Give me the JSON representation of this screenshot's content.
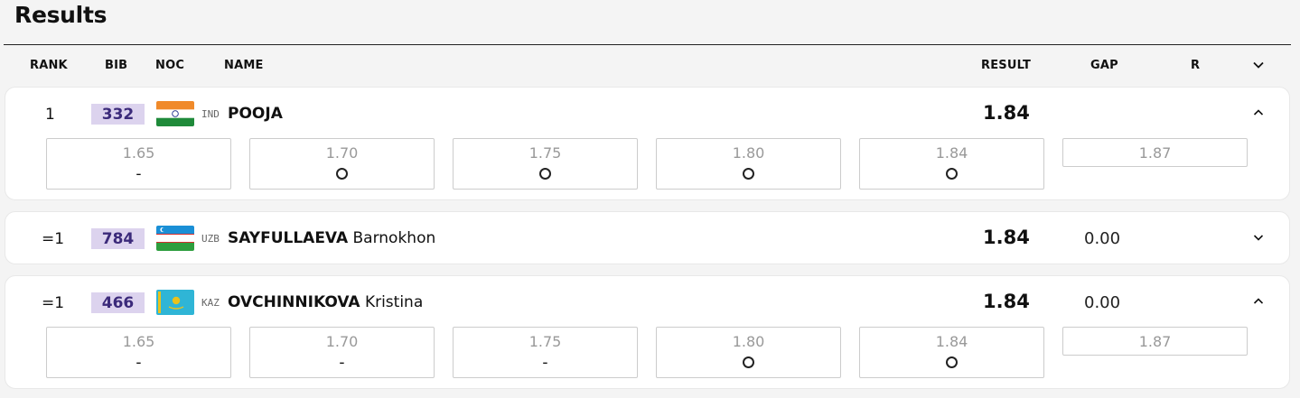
{
  "title": "Results",
  "headers": {
    "rank": "RANK",
    "bib": "BIB",
    "noc": "NOC",
    "name": "NAME",
    "result": "RESULT",
    "gap": "GAP",
    "r": "R"
  },
  "rows": [
    {
      "rank": "1",
      "bib": "332",
      "noc": "IND",
      "last": "POOJA",
      "first": "",
      "result": "1.84",
      "gap": "",
      "expanded": true,
      "attempts": [
        {
          "height": "1.65",
          "mark": "-"
        },
        {
          "height": "1.70",
          "mark": "O"
        },
        {
          "height": "1.75",
          "mark": "O"
        },
        {
          "height": "1.80",
          "mark": "O"
        },
        {
          "height": "1.84",
          "mark": "O"
        },
        {
          "height": "1.87",
          "mark": ""
        }
      ]
    },
    {
      "rank": "=1",
      "bib": "784",
      "noc": "UZB",
      "last": "SAYFULLAEVA",
      "first": "Barnokhon",
      "result": "1.84",
      "gap": "0.00",
      "expanded": false,
      "attempts": []
    },
    {
      "rank": "=1",
      "bib": "466",
      "noc": "KAZ",
      "last": "OVCHINNIKOVA",
      "first": "Kristina",
      "result": "1.84",
      "gap": "0.00",
      "expanded": true,
      "attempts": [
        {
          "height": "1.65",
          "mark": "-"
        },
        {
          "height": "1.70",
          "mark": "-"
        },
        {
          "height": "1.75",
          "mark": "-"
        },
        {
          "height": "1.80",
          "mark": "O"
        },
        {
          "height": "1.84",
          "mark": "O"
        },
        {
          "height": "1.87",
          "mark": ""
        }
      ]
    }
  ],
  "colors": {
    "bib_bg": "#dcd3ee",
    "bib_text": "#3b2a7a",
    "page_bg": "#f4f4f4"
  },
  "icons": {
    "expand": "chevron-down-icon",
    "collapse": "chevron-up-icon",
    "success": "circle-o-icon"
  }
}
